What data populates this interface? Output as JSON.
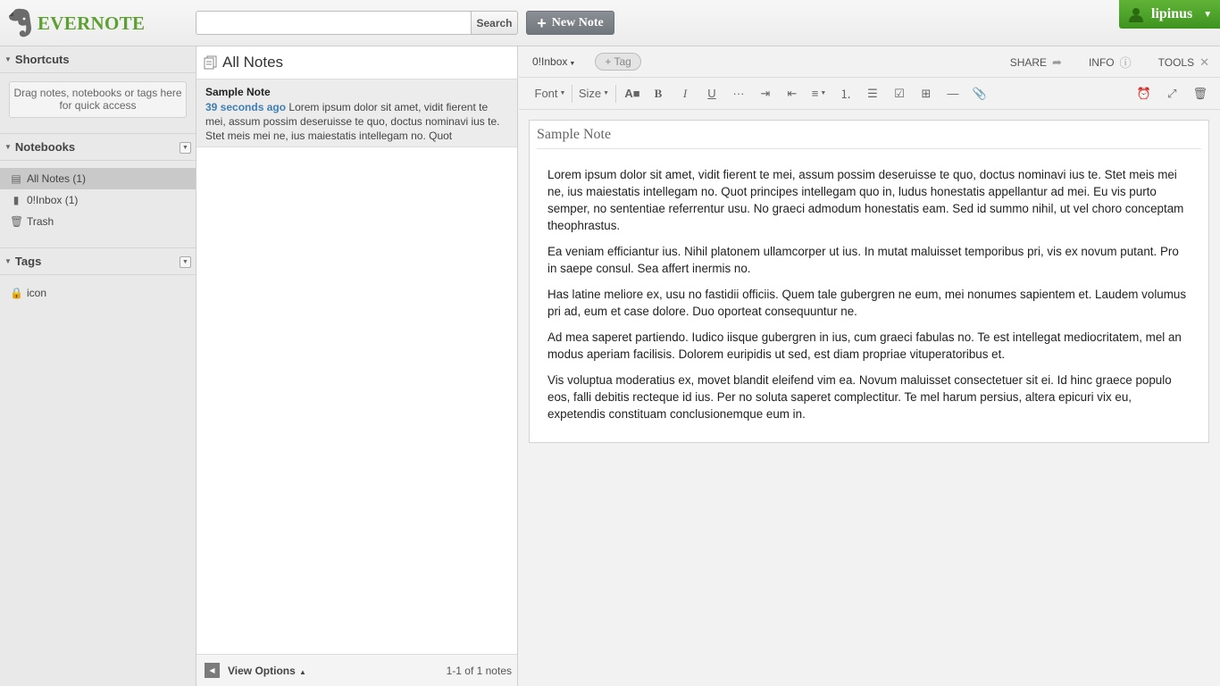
{
  "brand": {
    "name": "EVERNOTE"
  },
  "header": {
    "search_placeholder": "",
    "search_button": "Search",
    "new_note_label": "New Note",
    "user_name": "lipinus"
  },
  "sidebar": {
    "shortcuts_title": "Shortcuts",
    "shortcuts_hint": "Drag notes, notebooks or tags here for quick access",
    "notebooks_title": "Notebooks",
    "notebooks": [
      {
        "label": "All Notes",
        "count": "(1)",
        "icon": "all-notes-icon"
      },
      {
        "label": "0!Inbox",
        "count": "(1)",
        "icon": "notebook-icon"
      },
      {
        "label": "Trash",
        "count": "",
        "icon": "trash-icon"
      }
    ],
    "tags_title": "Tags",
    "tags": [
      {
        "label": "icon",
        "icon": "tag-icon"
      }
    ]
  },
  "notelist": {
    "title": "All Notes",
    "notes": [
      {
        "title": "Sample Note",
        "age": "39 seconds ago",
        "snippet": "Lorem ipsum dolor sit amet, vidit fierent te mei, assum possim deseruisse te quo, doctus nominavi ius te. Stet meis mei ne, ius maiestatis intellegam no. Quot"
      }
    ],
    "view_options": "View Options",
    "count_text": "1-1 of 1 notes"
  },
  "editor": {
    "notebook": "0!Inbox",
    "tag_placeholder": "+ Tag",
    "actions": {
      "share": "SHARE",
      "info": "INFO",
      "tools": "TOOLS"
    },
    "toolbar": {
      "font": "Font",
      "size": "Size"
    },
    "note_title": "Sample Note",
    "paragraphs": [
      "Lorem ipsum dolor sit amet, vidit fierent te mei, assum possim deseruisse te quo, doctus nominavi ius te. Stet meis mei ne, ius maiestatis intellegam no. Quot principes intellegam quo in, ludus honestatis appellantur ad mei. Eu vis purto semper, no sententiae referrentur usu. No graeci admodum honestatis eam. Sed id summo nihil, ut vel choro conceptam theophrastus.",
      "Ea veniam efficiantur ius. Nihil platonem ullamcorper ut ius. In mutat maluisset temporibus pri, vis ex novum putant. Pro in saepe consul. Sea affert inermis no.",
      "Has latine meliore ex, usu no fastidii officiis. Quem tale gubergren ne eum, mei nonumes sapientem et. Laudem volumus pri ad, eum et case dolore. Duo oporteat consequuntur ne.",
      "Ad mea saperet partiendo. Iudico iisque gubergren in ius, cum graeci fabulas no. Te est intellegat mediocritatem, mel an modus aperiam facilisis. Dolorem euripidis ut sed, est diam propriae vituperatoribus et.",
      "Vis voluptua moderatius ex, movet blandit eleifend vim ea. Novum maluisset consectetuer sit ei. Id hinc graece populo eos, falli debitis recteque id ius. Per no soluta saperet complectitur. Te mel harum persius, altera epicuri vix eu, expetendis constituam conclusionemque eum in."
    ]
  },
  "colors": {
    "brand_green": "#5da032",
    "user_green": "#4ca529",
    "link_blue": "#3f7fb3"
  }
}
